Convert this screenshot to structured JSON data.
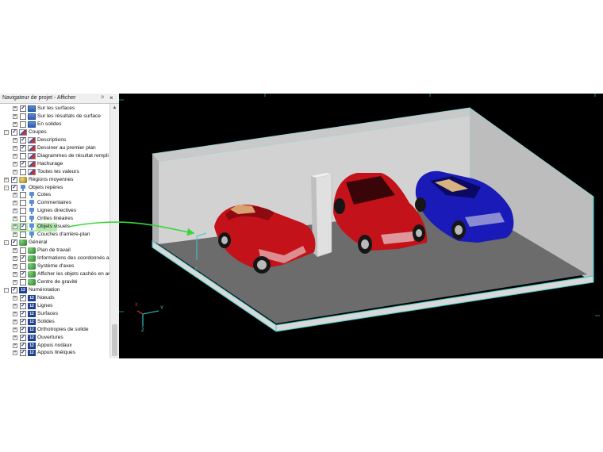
{
  "panel": {
    "title": "Navigateur de projet - Afficher",
    "pin_glyph": "ᵖ",
    "close_glyph": "×",
    "scroll_up_glyph": "▲"
  },
  "tree": [
    {
      "label": "Sur les surfaces",
      "checked": true,
      "icon": "surface-icon",
      "indent": 1
    },
    {
      "label": "Sur les résultats de surface",
      "checked": false,
      "icon": "surface-icon",
      "indent": 1
    },
    {
      "label": "En solides",
      "checked": false,
      "icon": "surface-icon",
      "indent": 1
    },
    {
      "label": "Coupes",
      "checked": true,
      "icon": "cut-icon",
      "indent": 0,
      "expander": "-"
    },
    {
      "label": "Descriptions",
      "checked": true,
      "icon": "cut-icon",
      "indent": 1
    },
    {
      "label": "Dessiner au premier plan",
      "checked": true,
      "icon": "cut-icon",
      "indent": 1
    },
    {
      "label": "Diagrammes de résultat rempli",
      "checked": false,
      "icon": "cut-icon",
      "indent": 1
    },
    {
      "label": "Hachurage",
      "checked": true,
      "icon": "cut-icon",
      "indent": 1
    },
    {
      "label": "Toutes les valeurs",
      "checked": false,
      "icon": "cut-icon",
      "indent": 1
    },
    {
      "label": "Régions moyennes",
      "checked": true,
      "icon": "region-icon",
      "indent": 0,
      "expander": "+"
    },
    {
      "label": "Objets repères",
      "checked": true,
      "icon": "reference-icon",
      "indent": 0,
      "expander": "-"
    },
    {
      "label": "Cotes",
      "checked": false,
      "icon": "reference-icon",
      "indent": 1
    },
    {
      "label": "Commentaires",
      "checked": false,
      "icon": "reference-icon",
      "indent": 1
    },
    {
      "label": "Lignes directives",
      "checked": false,
      "icon": "reference-icon",
      "indent": 1
    },
    {
      "label": "Grilles linéaires",
      "checked": false,
      "icon": "reference-icon",
      "indent": 1
    },
    {
      "label": "Objets visuels",
      "checked": true,
      "icon": "reference-icon",
      "indent": 1
    },
    {
      "label": "Couches d'arrière-plan",
      "checked": false,
      "icon": "reference-icon",
      "indent": 1
    },
    {
      "label": "Général",
      "checked": true,
      "icon": "general-icon",
      "indent": 0,
      "expander": "-"
    },
    {
      "label": "Plan de travail",
      "checked": false,
      "icon": "general-icon",
      "indent": 1
    },
    {
      "label": "Informations des coordonnés a",
      "checked": true,
      "icon": "general-icon",
      "indent": 1
    },
    {
      "label": "Système d'axes",
      "checked": false,
      "icon": "general-icon",
      "indent": 1
    },
    {
      "label": "Afficher les objets cachés en ar",
      "checked": true,
      "icon": "general-icon",
      "indent": 1
    },
    {
      "label": "Centre de gravité",
      "checked": false,
      "icon": "general-icon",
      "indent": 1
    },
    {
      "label": "Numérotation",
      "checked": true,
      "icon": "numbering-icon",
      "indent": 0,
      "expander": "-"
    },
    {
      "label": "Nœuds",
      "checked": true,
      "icon": "numbering-icon",
      "indent": 1
    },
    {
      "label": "Lignes",
      "checked": true,
      "icon": "numbering-icon",
      "indent": 1
    },
    {
      "label": "Surfaces",
      "checked": true,
      "icon": "numbering-icon",
      "indent": 1
    },
    {
      "label": "Solides",
      "checked": true,
      "icon": "numbering-icon",
      "indent": 1
    },
    {
      "label": "Orthotropies de solide",
      "checked": true,
      "icon": "numbering-icon",
      "indent": 1
    },
    {
      "label": "Ouvertures",
      "checked": true,
      "icon": "numbering-icon",
      "indent": 1
    },
    {
      "label": "Appuis nodaux",
      "checked": true,
      "icon": "numbering-icon",
      "indent": 1
    },
    {
      "label": "Appuis linéiques",
      "checked": true,
      "icon": "numbering-icon",
      "indent": 1
    }
  ],
  "highlighted_item": "Objets visuels",
  "axis_labels": {
    "x": "X",
    "y": "Y",
    "z": "Z"
  },
  "colors": {
    "highlight": "#a6e6a0",
    "arrow": "#3ad63a",
    "car_red": "#c4121a",
    "car_blue": "#1a1ab8",
    "floor": "#6c6c6c",
    "wall": "#c9c9c9",
    "edge": "#40c8c8"
  }
}
